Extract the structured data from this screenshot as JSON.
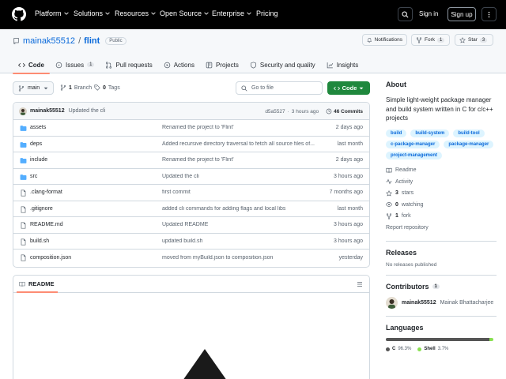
{
  "topnav": {
    "items": [
      "Platform",
      "Solutions",
      "Resources",
      "Open Source",
      "Enterprise",
      "Pricing"
    ],
    "sign_in": "Sign in",
    "sign_up": "Sign up"
  },
  "repo": {
    "owner": "mainak55512",
    "separator": "/",
    "name": "flint",
    "visibility": "Public",
    "notifications_label": "Notifications",
    "fork_label": "Fork",
    "fork_count": "1",
    "star_label": "Star",
    "star_count": "3"
  },
  "tabs": [
    {
      "label": "Code",
      "icon": "code-icon"
    },
    {
      "label": "Issues",
      "count": "1",
      "icon": "issue-icon"
    },
    {
      "label": "Pull requests",
      "icon": "pull-request-icon"
    },
    {
      "label": "Actions",
      "icon": "actions-icon"
    },
    {
      "label": "Projects",
      "icon": "projects-icon"
    },
    {
      "label": "Security and quality",
      "icon": "shield-icon"
    },
    {
      "label": "Insights",
      "icon": "graph-icon"
    }
  ],
  "branch_bar": {
    "branch": "main",
    "branch_count": "1",
    "branch_label": "Branch",
    "tag_count": "0",
    "tag_label": "Tags",
    "goto_placeholder": "Go to file",
    "code_button": "Code"
  },
  "latest_commit": {
    "author": "mainak55512",
    "message": "Updated the cli",
    "hash": "d5a5527",
    "dot": "·",
    "age": "3 hours ago",
    "commit_count": "46 Commits"
  },
  "files": [
    {
      "name": "assets",
      "type": "folder",
      "message": "Renamed the project to 'Flint'",
      "age": "2 days ago"
    },
    {
      "name": "deps",
      "type": "folder",
      "message": "Added recursive directory traversal to fetch all source files of...",
      "age": "last month"
    },
    {
      "name": "include",
      "type": "folder",
      "message": "Renamed the project to 'Flint'",
      "age": "2 days ago"
    },
    {
      "name": "src",
      "type": "folder",
      "message": "Updated the cli",
      "age": "3 hours ago"
    },
    {
      "name": ".clang-format",
      "type": "file",
      "message": "first commit",
      "age": "7 months ago"
    },
    {
      "name": ".gitignore",
      "type": "file",
      "message": "added cli commands for adding flags and local libs",
      "age": "last month"
    },
    {
      "name": "README.md",
      "type": "file",
      "message": "Updated README",
      "age": "3 hours ago"
    },
    {
      "name": "build.sh",
      "type": "file",
      "message": "updated build.sh",
      "age": "3 hours ago"
    },
    {
      "name": "composition.json",
      "type": "file",
      "message": "moved from myBuild.json to composition.json",
      "age": "yesterday"
    }
  ],
  "readme": {
    "title": "README"
  },
  "about": {
    "heading": "About",
    "description": "Simple light-weight package manager and build system written in C for c/c++ projects",
    "topics": [
      "build",
      "build-system",
      "build-tool",
      "c-package-manager",
      "package-manager",
      "project-management"
    ],
    "links": [
      {
        "icon": "book-icon",
        "value": "",
        "label": "Readme"
      },
      {
        "icon": "pulse-icon",
        "value": "",
        "label": "Activity"
      },
      {
        "icon": "star-icon",
        "value": "3",
        "label": "stars"
      },
      {
        "icon": "eye-icon",
        "value": "0",
        "label": "watching"
      },
      {
        "icon": "fork-icon",
        "value": "1",
        "label": "fork"
      }
    ],
    "report": "Report repository"
  },
  "releases": {
    "heading": "Releases",
    "empty": "No releases published"
  },
  "contributors": {
    "heading": "Contributors",
    "count": "1",
    "people": [
      {
        "login": "mainak55512",
        "name": "Mainak Bhattacharjee"
      }
    ]
  },
  "languages": {
    "heading": "Languages",
    "items": [
      {
        "name": "C",
        "percent": "96.3%",
        "value": 96.3,
        "color": "#555555"
      },
      {
        "name": "Shell",
        "percent": "3.7%",
        "value": 3.7,
        "color": "#89e051"
      }
    ]
  }
}
